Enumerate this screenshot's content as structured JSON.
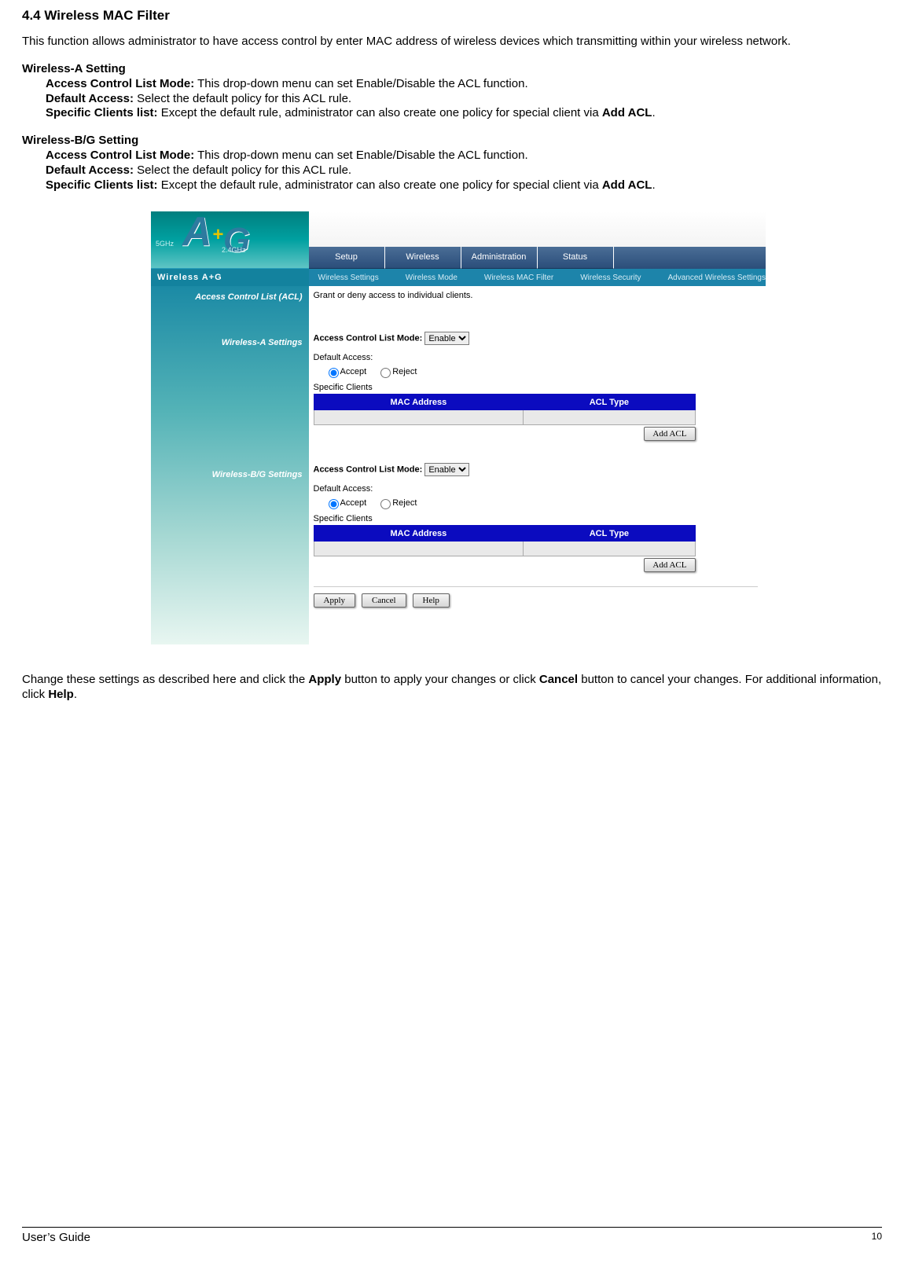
{
  "section_title": "4.4 Wireless MAC Filter",
  "intro": "This function allows administrator to have access control by enter MAC address of wireless devices which transmitting within your wireless network.",
  "wa": {
    "heading": "Wireless-A Setting",
    "acl_mode_label": "Access Control List Mode:",
    "acl_mode_text": " This drop-down menu can set Enable/Disable the ACL function.",
    "default_access_label": "Default Access:",
    "default_access_text": " Select the default policy for this ACL rule.",
    "specific_label": "Specific Clients list:",
    "specific_text": " Except the default rule, administrator can also create one policy for special client via ",
    "addacl_bold": "Add ACL"
  },
  "wbg": {
    "heading": "Wireless-B/G Setting",
    "acl_mode_label": "Access Control List Mode:",
    "acl_mode_text": " This drop-down menu can set Enable/Disable the ACL function.",
    "default_access_label": "Default Access:",
    "default_access_text": " Select the default policy for this ACL rule.",
    "specific_label": "Specific Clients list:",
    "specific_text": " Except the default rule, administrator can also create one policy for special client via ",
    "addacl_bold": "Add ACL"
  },
  "panel": {
    "logo": {
      "a": "A",
      "plus": "+",
      "g": "G",
      "badge5": "5GHz",
      "badge24": "2.4GHz"
    },
    "tabs": [
      "Setup",
      "Wireless",
      "Administration",
      "Status"
    ],
    "product": "Wireless A+G",
    "subnav": [
      "Wireless Settings",
      "Wireless Mode",
      "Wireless MAC Filter",
      "Wireless Security",
      "Advanced Wireless Settings"
    ],
    "left_labels": {
      "acl": "Access Control List (ACL)",
      "wa": "Wireless-A Settings",
      "wbg": "Wireless-B/G Settings"
    },
    "desc": "Grant or deny access to individual clients.",
    "acl_mode_label": "Access Control List Mode:",
    "acl_mode_value": "Enable",
    "default_access_label": "Default Access:",
    "radio_accept": "Accept",
    "radio_reject": "Reject",
    "specific_clients": "Specific Clients",
    "col_mac": "MAC Address",
    "col_type": "ACL Type",
    "btn_addacl": "Add ACL",
    "btn_apply": "Apply",
    "btn_cancel": "Cancel",
    "btn_help": "Help"
  },
  "outro_1a": "Change these settings as described here and click the ",
  "outro_1b": "Apply",
  "outro_1c": " button to apply your changes or click ",
  "outro_1d": "Cancel",
  "outro_1e": " button to cancel your changes. For additional information, click ",
  "outro_1f": "Help",
  "outro_1g": ".",
  "footer_left": "User’s Guide",
  "footer_page": "10"
}
